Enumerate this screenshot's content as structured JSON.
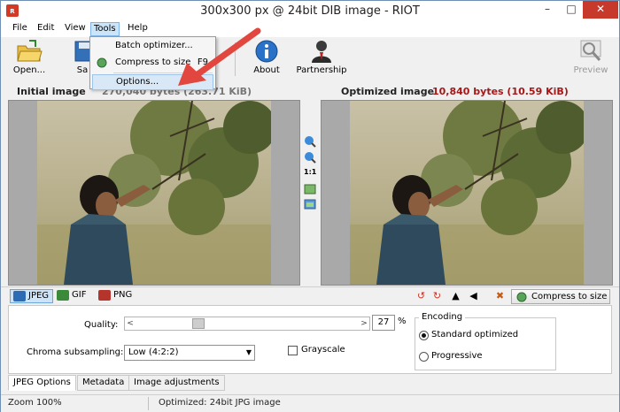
{
  "window": {
    "title": "300x300 px @ 24bit  DIB image - RIOT",
    "min_glyph": "–",
    "max_glyph": "□",
    "close_glyph": "✕"
  },
  "menu": {
    "file": "File",
    "edit": "Edit",
    "view": "View",
    "tools": "Tools",
    "help": "Help"
  },
  "tools_menu": {
    "batch": "Batch optimizer...",
    "compress": "Compress to size",
    "compress_shortcut": "F9",
    "options": "Options..."
  },
  "toolbar": {
    "open": "Open...",
    "save_visible": "Sa",
    "about": "About",
    "partnership": "Partnership",
    "preview": "Preview"
  },
  "header": {
    "initial_label": "Initial image",
    "initial_size_visible": "270,040 bytes (263.71 KiB)",
    "optimized_label": "Optimized image",
    "optimized_size": "10,840 bytes (10.59 KiB)"
  },
  "center_tools": {
    "one_to_one": "1:1"
  },
  "formats": {
    "jpeg": "JPEG",
    "gif": "GIF",
    "png": "PNG",
    "compress_button": "Compress to size"
  },
  "settings": {
    "quality_label": "Quality:",
    "quality_value": "27",
    "quality_unit": "%",
    "quality_slider_fraction": 0.27,
    "chroma_label": "Chroma subsampling:",
    "chroma_value": "Low (4:2:2)",
    "grayscale_label": "Grayscale",
    "encoding_title": "Encoding",
    "encoding_standard": "Standard optimized",
    "encoding_progressive": "Progressive"
  },
  "bottom_tabs": {
    "jpeg_options": "JPEG Options",
    "metadata": "Metadata",
    "image_adjustments": "Image adjustments"
  },
  "status": {
    "zoom": "Zoom 100%",
    "info": "Optimized: 24bit JPG image"
  },
  "colors": {
    "accent_red": "#a31818",
    "arrow_red": "#e2473f",
    "highlight_blue": "#cde4f8"
  }
}
